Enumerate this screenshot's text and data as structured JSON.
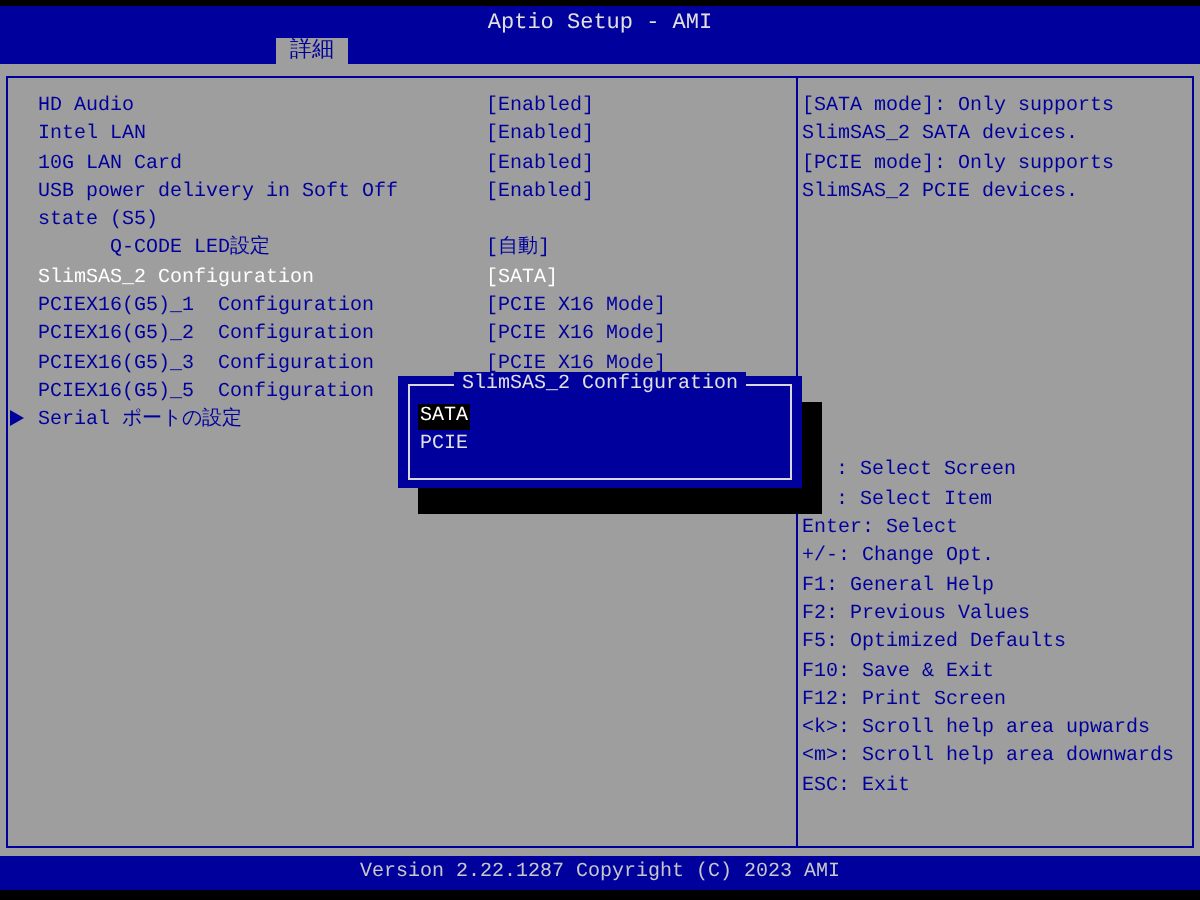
{
  "window": {
    "title": "Aptio Setup - AMI"
  },
  "tabs": [
    {
      "label": "詳細",
      "selected": true
    }
  ],
  "settings": [
    {
      "kind": "option",
      "label": "HD Audio",
      "value": "[Enabled]",
      "selected": false
    },
    {
      "kind": "option",
      "label": "Intel LAN",
      "value": "[Enabled]",
      "selected": false
    },
    {
      "kind": "option",
      "label": "10G LAN Card",
      "value": "[Enabled]",
      "selected": false
    },
    {
      "kind": "option",
      "label": "USB power delivery in Soft Off state (S5)",
      "value": "[Enabled]",
      "selected": false
    },
    {
      "kind": "indented",
      "label": "Q-CODE LED設定",
      "value": "[自動]",
      "selected": false
    },
    {
      "kind": "option",
      "label": "SlimSAS_2 Configuration",
      "value": "[SATA]",
      "selected": true
    },
    {
      "kind": "option",
      "label": "PCIEX16(G5)_1  Configuration",
      "value": "[PCIE X16 Mode]",
      "selected": false
    },
    {
      "kind": "option",
      "label": "PCIEX16(G5)_2  Configuration",
      "value": "[PCIE X16 Mode]",
      "selected": false
    },
    {
      "kind": "option",
      "label": "PCIEX16(G5)_3  Configuration",
      "value": "[PCIE X16 Mode]",
      "selected": false
    },
    {
      "kind": "option",
      "label": "PCIEX16(G5)_5  Configuration",
      "selected": false
    },
    {
      "kind": "submenu",
      "label": "Serial ポートの設定",
      "selected": false
    }
  ],
  "help": {
    "description": [
      "[SATA mode]: Only supports SlimSAS_2 SATA devices.",
      "[PCIE mode]: Only supports SlimSAS_2 PCIE devices."
    ],
    "keys": [
      {
        "kind": "hidden-key",
        "text": ": Select Screen"
      },
      {
        "kind": "hidden-key",
        "text": ": Select Item"
      },
      {
        "kind": "plain",
        "text": "Enter: Select"
      },
      {
        "kind": "plain",
        "text": "+/-: Change Opt."
      },
      {
        "kind": "plain",
        "text": "F1: General Help"
      },
      {
        "kind": "plain",
        "text": "F2: Previous Values"
      },
      {
        "kind": "plain",
        "text": "F5: Optimized Defaults"
      },
      {
        "kind": "plain",
        "text": "F10: Save & Exit"
      },
      {
        "kind": "plain",
        "text": "F12: Print Screen"
      },
      {
        "kind": "plain",
        "text": "<k>: Scroll help area upwards"
      },
      {
        "kind": "plain",
        "text": "<m>: Scroll help area downwards"
      },
      {
        "kind": "plain",
        "text": "ESC: Exit"
      }
    ]
  },
  "popup": {
    "title": "SlimSAS_2 Configuration",
    "options": [
      {
        "label": "SATA",
        "selected": true
      },
      {
        "label": "PCIE",
        "selected": false
      }
    ]
  },
  "status_bar": {
    "text": "Version 2.22.1287 Copyright (C) 2023 AMI"
  }
}
